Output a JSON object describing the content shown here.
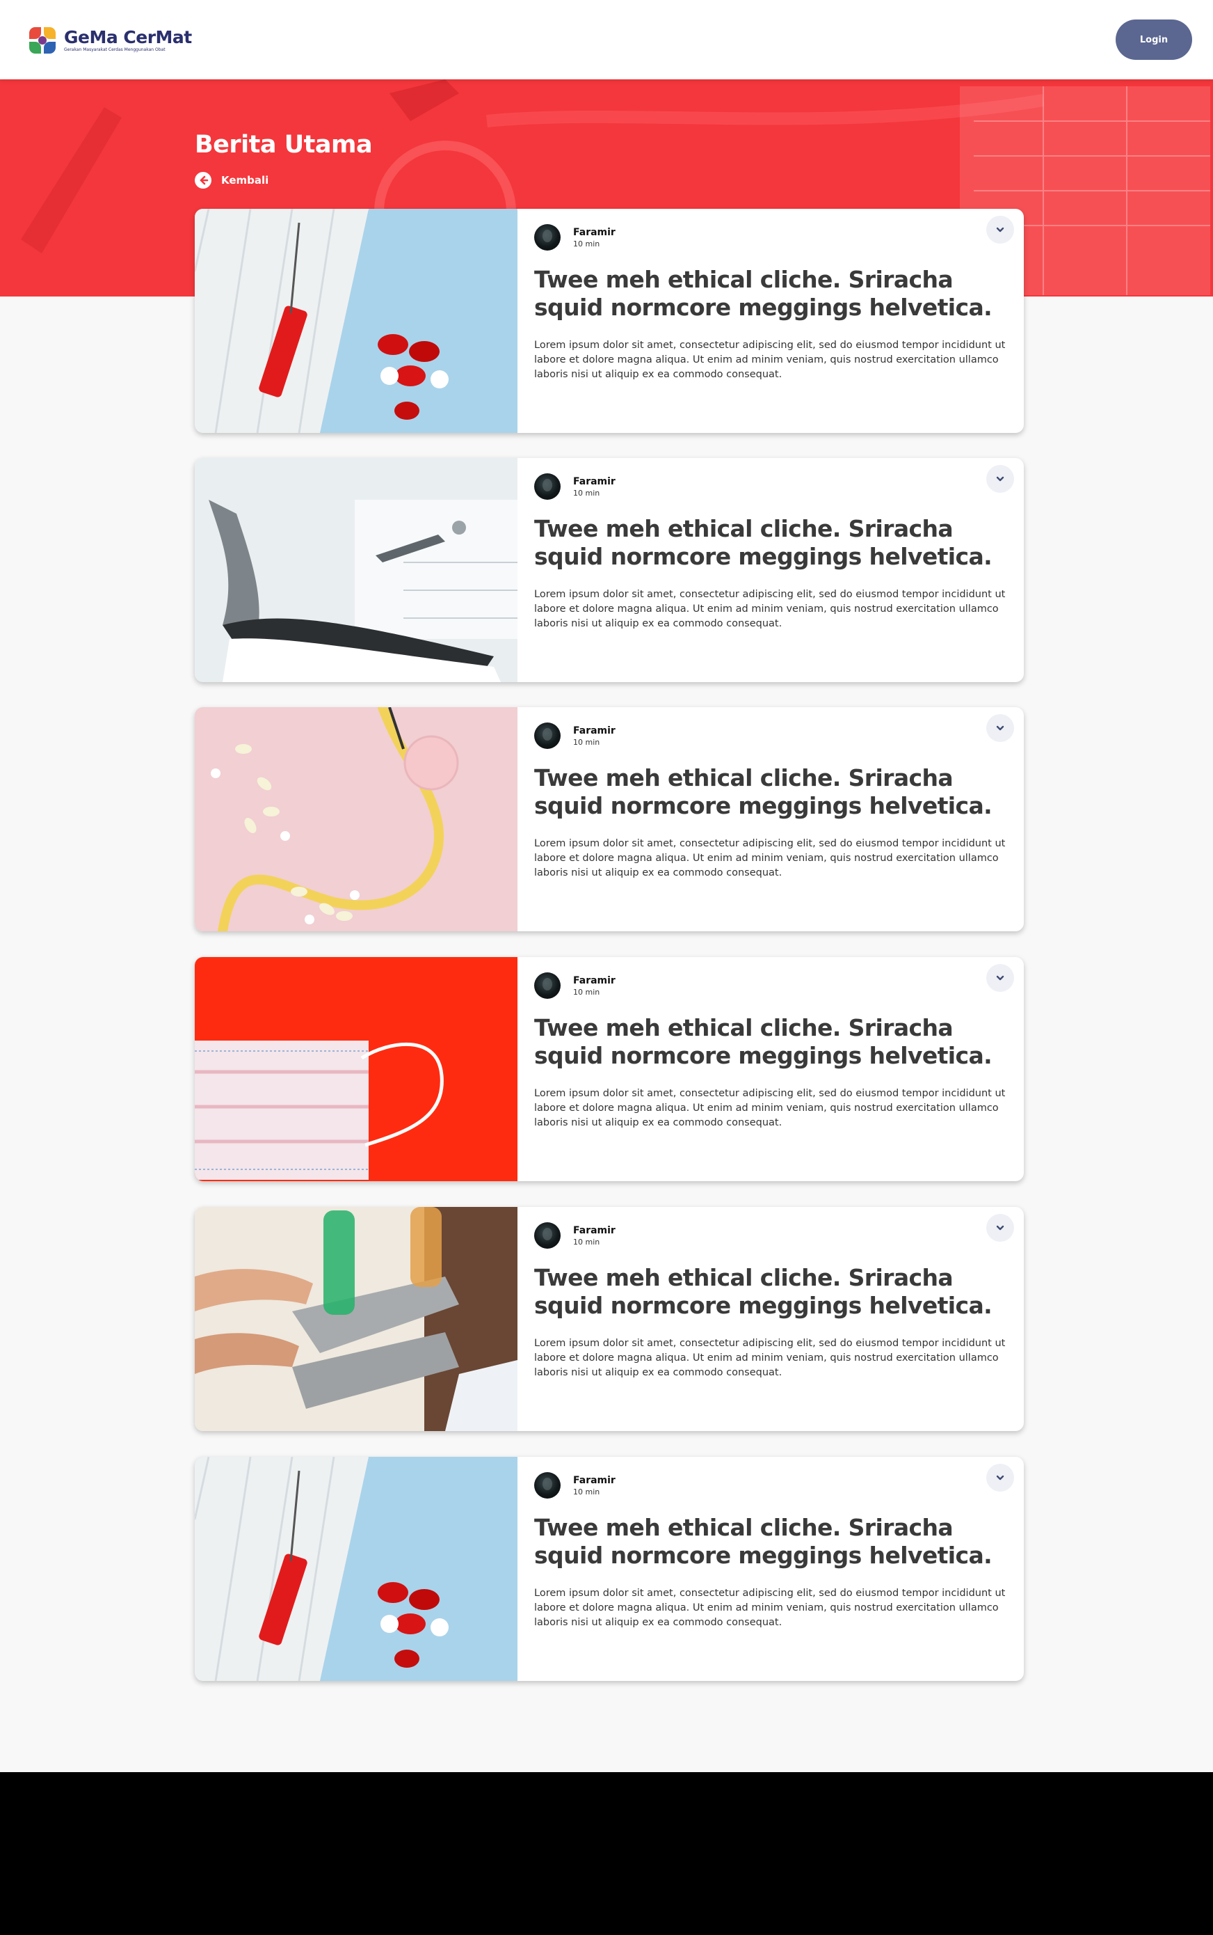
{
  "header": {
    "logo_title": "GeMa CerMat",
    "logo_subtitle": "Gerakan Masyarakat Cerdas Menggunakan Obat",
    "login_label": "Login"
  },
  "hero": {
    "title": "Berita Utama",
    "back_label": "Kembali"
  },
  "colors": {
    "hero_red": "#f4373c",
    "login_button": "#5b6791",
    "title_text": "#3a3a3a"
  },
  "articles": [
    {
      "image": "syringe-mask-pills",
      "author": "Faramir",
      "read_time": "10 min",
      "title": "Twee meh ethical cliche. Sriracha squid normcore meggings helvetica.",
      "excerpt": "Lorem ipsum dolor sit amet, consectetur adipiscing elit, sed do eiusmod tempor incididunt ut labore et dolore magna aliqua. Ut enim ad minim veniam, quis nostrud exercitation ullamco laboris nisi ut aliquip ex ea commodo consequat."
    },
    {
      "image": "dental-chair",
      "author": "Faramir",
      "read_time": "10 min",
      "title": "Twee meh ethical cliche. Sriracha squid normcore meggings helvetica.",
      "excerpt": "Lorem ipsum dolor sit amet, consectetur adipiscing elit, sed do eiusmod tempor incididunt ut labore et dolore magna aliqua. Ut enim ad minim veniam, quis nostrud exercitation ullamco laboris nisi ut aliquip ex ea commodo consequat."
    },
    {
      "image": "stethoscope-pills",
      "author": "Faramir",
      "read_time": "10 min",
      "title": "Twee meh ethical cliche. Sriracha squid normcore meggings helvetica.",
      "excerpt": "Lorem ipsum dolor sit amet, consectetur adipiscing elit, sed do eiusmod tempor incididunt ut labore et dolore magna aliqua. Ut enim ad minim veniam, quis nostrud exercitation ullamco laboris nisi ut aliquip ex ea commodo consequat."
    },
    {
      "image": "face-mask-red",
      "author": "Faramir",
      "read_time": "10 min",
      "title": "Twee meh ethical cliche. Sriracha squid normcore meggings helvetica.",
      "excerpt": "Lorem ipsum dolor sit amet, consectetur adipiscing elit, sed do eiusmod tempor incididunt ut labore et dolore magna aliqua. Ut enim ad minim veniam, quis nostrud exercitation ullamco laboris nisi ut aliquip ex ea commodo consequat."
    },
    {
      "image": "test-tubes",
      "author": "Faramir",
      "read_time": "10 min",
      "title": "Twee meh ethical cliche. Sriracha squid normcore meggings helvetica.",
      "excerpt": "Lorem ipsum dolor sit amet, consectetur adipiscing elit, sed do eiusmod tempor incididunt ut labore et dolore magna aliqua. Ut enim ad minim veniam, quis nostrud exercitation ullamco laboris nisi ut aliquip ex ea commodo consequat."
    },
    {
      "image": "syringe-mask-pills",
      "author": "Faramir",
      "read_time": "10 min",
      "title": "Twee meh ethical cliche. Sriracha squid normcore meggings helvetica.",
      "excerpt": "Lorem ipsum dolor sit amet, consectetur adipiscing elit, sed do eiusmod tempor incididunt ut labore et dolore magna aliqua. Ut enim ad minim veniam, quis nostrud exercitation ullamco laboris nisi ut aliquip ex ea commodo consequat."
    }
  ]
}
